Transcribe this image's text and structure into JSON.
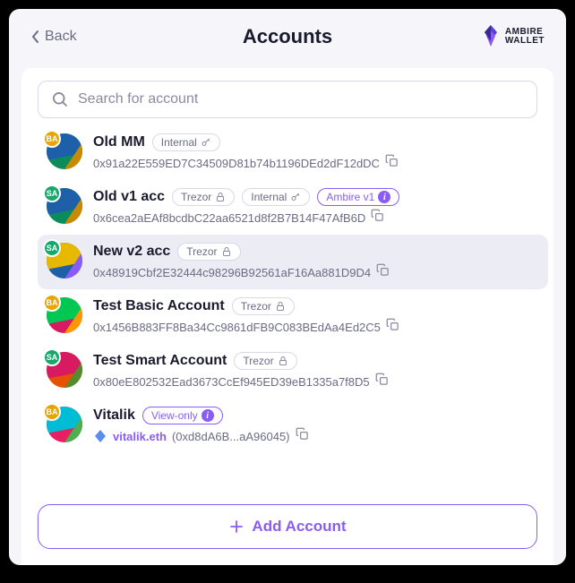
{
  "header": {
    "back_label": "Back",
    "title": "Accounts",
    "brand_line1": "AMBIRE",
    "brand_line2": "WALLET"
  },
  "search": {
    "placeholder": "Search for account"
  },
  "accounts": [
    {
      "name": "Old MM",
      "badge": "BA",
      "badge_class": "ba",
      "avatar_colors": [
        "#0a8c5c",
        "#1d5fa8",
        "#c78a00"
      ],
      "tags": [
        {
          "label": "Internal",
          "icon": "key",
          "style": "default"
        }
      ],
      "address": "0x91a22E559ED7C34509D81b74b1196DEd2dF12dDC"
    },
    {
      "name": "Old v1 acc",
      "badge": "SA",
      "badge_class": "sa",
      "avatar_colors": [
        "#0a8c5c",
        "#1d5fa8",
        "#c78a00"
      ],
      "tags": [
        {
          "label": "Trezor",
          "icon": "lock",
          "style": "default"
        },
        {
          "label": "Internal",
          "icon": "key",
          "style": "default"
        },
        {
          "label": "Ambire v1",
          "icon": "info",
          "style": "purple"
        }
      ],
      "address": "0x6cea2aEAf8bcdbC22aa6521d8f2B7B14F47AfB6D"
    },
    {
      "name": "New v2 acc",
      "badge": "SA",
      "badge_class": "sa",
      "selected": true,
      "avatar_colors": [
        "#1d5fa8",
        "#e6b800",
        "#8a5cf6"
      ],
      "tags": [
        {
          "label": "Trezor",
          "icon": "lock",
          "style": "default"
        }
      ],
      "address": "0x48919Cbf2E32444c98296B92561aF16Aa881D9D4"
    },
    {
      "name": "Test Basic Account",
      "badge": "BA",
      "badge_class": "ba",
      "avatar_colors": [
        "#d81b60",
        "#00c853",
        "#ff9800"
      ],
      "tags": [
        {
          "label": "Trezor",
          "icon": "lock",
          "style": "default"
        }
      ],
      "address": "0x1456B883FF8Ba34Cc9861dFB9C083BEdAa4Ed2C5"
    },
    {
      "name": "Test Smart Account",
      "badge": "SA",
      "badge_class": "sa",
      "avatar_colors": [
        "#e65100",
        "#d81b60",
        "#558b2f"
      ],
      "tags": [
        {
          "label": "Trezor",
          "icon": "lock",
          "style": "default"
        }
      ],
      "address": "0x80eE802532Ead3673CcEf945ED39eB1335a7f8D5"
    },
    {
      "name": "Vitalik",
      "badge": "BA",
      "badge_class": "ba",
      "avatar_colors": [
        "#e91e63",
        "#00bcd4",
        "#4caf50"
      ],
      "tags": [
        {
          "label": "View-only",
          "icon": "info",
          "style": "purple"
        }
      ],
      "ens": "vitalik.eth",
      "address_short": "(0xd8dA6B...aA96045)"
    }
  ],
  "footer": {
    "add_label": "Add Account"
  }
}
